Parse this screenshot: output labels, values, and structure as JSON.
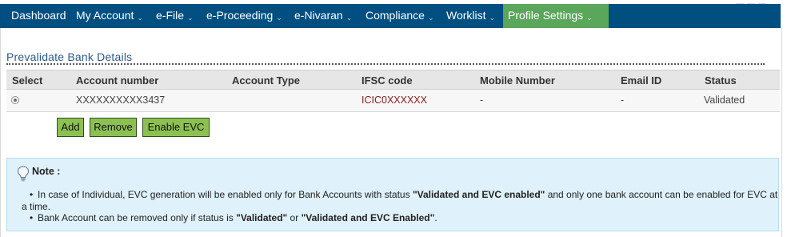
{
  "nav": {
    "items": [
      {
        "label": "Dashboard",
        "dropdown": false
      },
      {
        "label": "My Account",
        "dropdown": true
      },
      {
        "label": "e-File",
        "dropdown": true
      },
      {
        "label": "e-Proceeding",
        "dropdown": true
      },
      {
        "label": "e-Nivaran",
        "dropdown": true
      },
      {
        "label": "Compliance",
        "dropdown": true
      },
      {
        "label": "Worklist",
        "dropdown": true
      },
      {
        "label": "Profile Settings",
        "dropdown": true,
        "active": true
      }
    ],
    "caret": "⌄",
    "colors": {
      "bar": "#004f80",
      "active": "#5aa65a"
    }
  },
  "section": {
    "title": "Prevalidate Bank Details"
  },
  "table": {
    "headers": [
      "Select",
      "Account number",
      "Account Type",
      "IFSC code",
      "Mobile Number",
      "Email ID",
      "Status"
    ],
    "rows": [
      {
        "account_number": "XXXXXXXXXX3437",
        "account_type": "",
        "ifsc": "ICIC0XXXXXX",
        "mobile": "-",
        "email": "-",
        "status": "Validated",
        "selected": true
      }
    ]
  },
  "buttons": {
    "add": "Add",
    "remove": "Remove",
    "enable_evc": "Enable EVC",
    "color": "#8cc152"
  },
  "note": {
    "icon": "lightbulb-icon",
    "title": "Note :",
    "line1_a": "In case of Individual, EVC generation will be enabled only for Bank Accounts with status ",
    "line1_b": "\"Validated and EVC enabled\"",
    "line1_c": " and only one bank account can be enabled for EVC at a time.",
    "line2_a": "Bank Account can be removed only if status is ",
    "line2_b": "\"Validated\"",
    "line2_c": " or ",
    "line2_d": "\"Validated and EVC Enabled\"",
    "line2_e": "."
  }
}
